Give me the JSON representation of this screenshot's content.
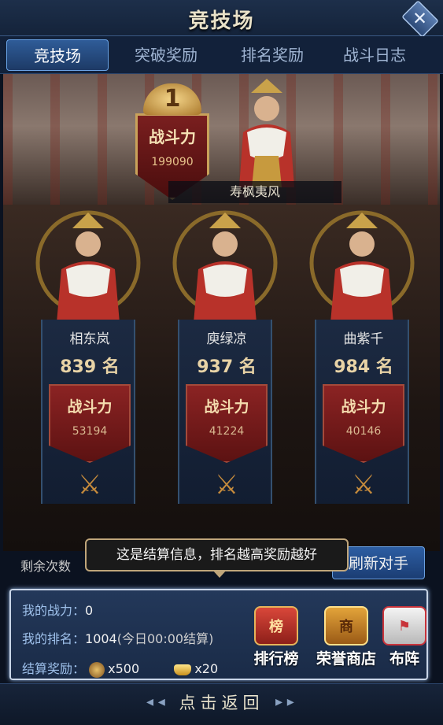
{
  "header": {
    "title": "竞技场",
    "close_symbol": "✕"
  },
  "tabs": [
    {
      "label": "竞技场"
    },
    {
      "label": "突破奖励"
    },
    {
      "label": "排名奖励"
    },
    {
      "label": "战斗日志"
    }
  ],
  "champion": {
    "rank": "1",
    "power_label": "战斗力",
    "power_value": "199090",
    "name": "寿枫夷风"
  },
  "opponents": [
    {
      "name": "相东岚",
      "rank": "839 名",
      "power_label": "战斗力",
      "power_value": "53194"
    },
    {
      "name": "庾绿凉",
      "rank": "937 名",
      "power_label": "战斗力",
      "power_value": "41224"
    },
    {
      "name": "曲紫千",
      "rank": "984 名",
      "power_label": "战斗力",
      "power_value": "40146"
    }
  ],
  "remaining_label": "剩余次数",
  "refresh_label": "刷新对手",
  "tooltip": "这是结算信息，排名越高奖励越好",
  "info": {
    "power_label": "我的战力：",
    "power_value": "0",
    "rank_label": "我的排名：",
    "rank_value": "1004",
    "rank_note": "(今日00:00结算)",
    "reward_label": "结算奖励：",
    "reward1_value": "x500",
    "reward2_value": "x20"
  },
  "actions": {
    "leaderboard": "排行榜",
    "honor_shop": "荣誉商店",
    "formation": "布阵",
    "leaderboard_glyph": "榜",
    "shop_glyph": "商"
  },
  "footer": {
    "back_label": "点击返回",
    "left_arrow": "◂ ◂",
    "right_arrow": "▸ ▸"
  }
}
